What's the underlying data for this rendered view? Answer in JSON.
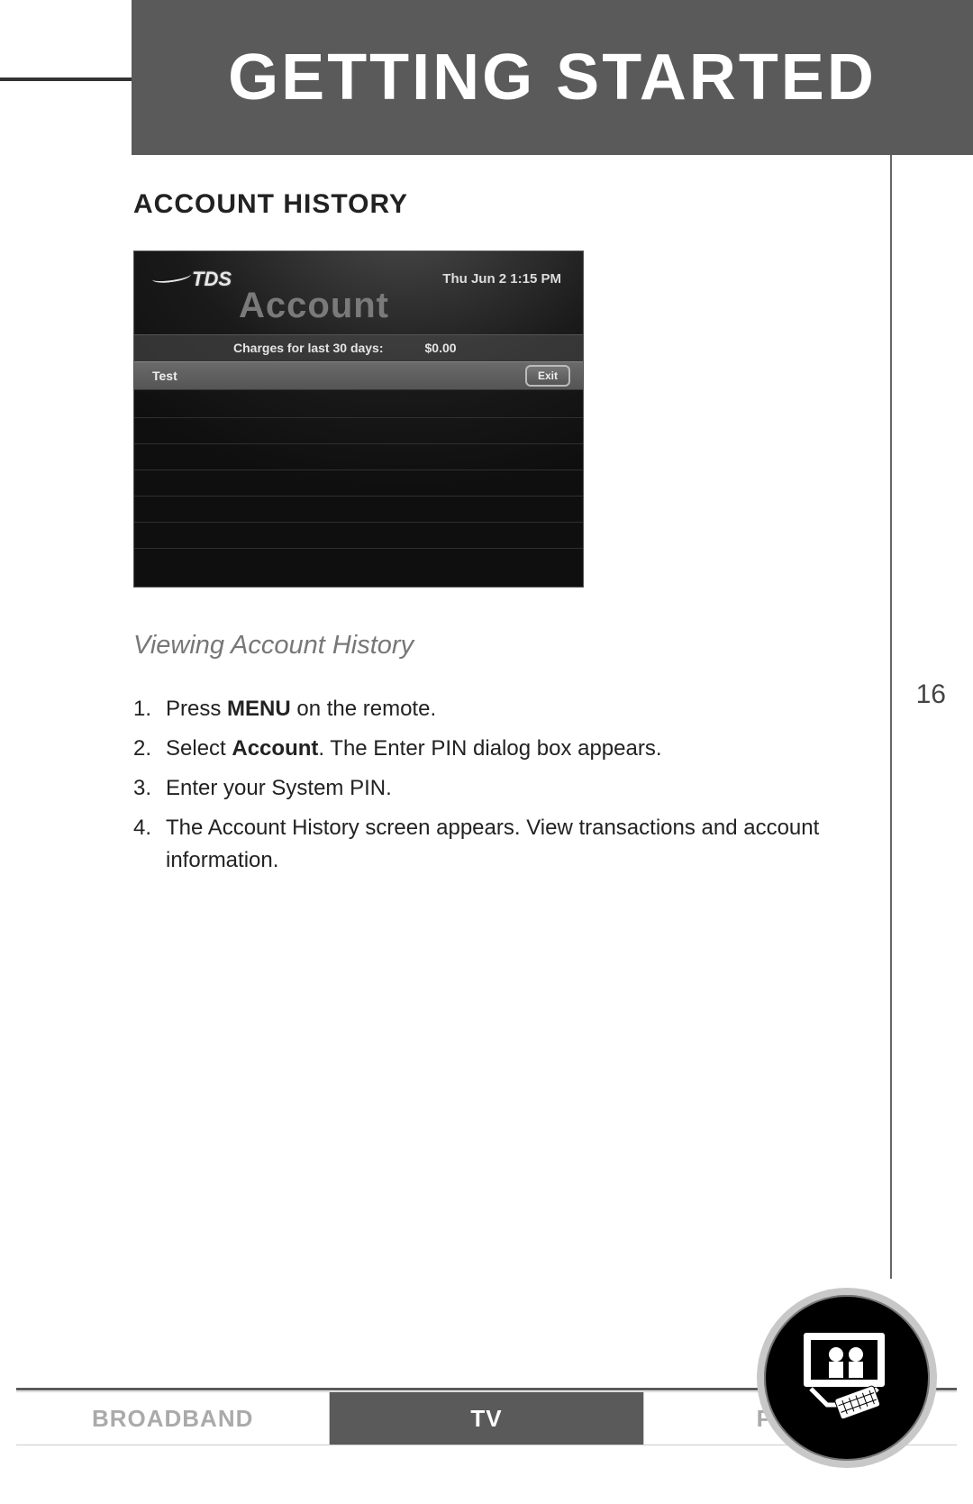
{
  "header": {
    "title": "GETTING STARTED"
  },
  "page_number": "16",
  "section": {
    "heading": "ACCOUNT HISTORY",
    "subheading": "Viewing Account History"
  },
  "screenshot": {
    "logo_text": "TDS",
    "datetime": "Thu Jun 2   1:15 PM",
    "big_title": "Account",
    "charges_label": "Charges for last 30 days:",
    "charges_amount": "$0.00",
    "row1_label": "Test",
    "exit_label": "Exit"
  },
  "steps": [
    {
      "pre": "Press ",
      "bold": "MENU",
      "post": " on the remote."
    },
    {
      "pre": "Select ",
      "bold": "Account",
      "post": ". The Enter PIN dialog box appears."
    },
    {
      "pre": "Enter your System PIN.",
      "bold": "",
      "post": ""
    },
    {
      "pre": "The Account History screen appears. View transactions and account information.",
      "bold": "",
      "post": ""
    }
  ],
  "footer": {
    "tabs": [
      "BROADBAND",
      "TV",
      "PHONE"
    ],
    "active_index": 1
  },
  "corner_icon_name": "tv-people-remote-icon"
}
